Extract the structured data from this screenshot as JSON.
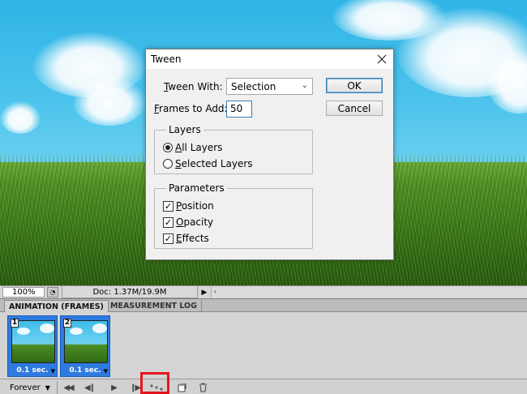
{
  "dialog": {
    "title": "Tween",
    "tween_with": {
      "label_underlined": "T",
      "label_rest": "ween With:",
      "value": "Selection"
    },
    "frames_to_add": {
      "label_pre": "",
      "label_underlined": "F",
      "label_rest": "rames to Add:",
      "value": "50"
    },
    "ok_label": "OK",
    "cancel_label": "Cancel",
    "layers": {
      "title": "Layers",
      "options": [
        {
          "u": "A",
          "rest": "ll Layers",
          "selected": true
        },
        {
          "u": "S",
          "rest": "elected Layers",
          "selected": false
        }
      ]
    },
    "parameters": {
      "title": "Parameters",
      "options": [
        {
          "u": "P",
          "rest": "osition",
          "checked": true
        },
        {
          "u": "O",
          "rest": "pacity",
          "checked": true
        },
        {
          "u": "E",
          "rest": "ffects",
          "checked": true
        }
      ]
    }
  },
  "status": {
    "zoom": "100%",
    "doc": "Doc: 1.37M/19.9M"
  },
  "panel": {
    "tabs": [
      "ANIMATION (FRAMES)",
      "MEASUREMENT LOG"
    ],
    "frames": [
      {
        "number": "1",
        "delay": "0.1 sec."
      },
      {
        "number": "2",
        "delay": "0.1 sec."
      }
    ],
    "loop": "Forever"
  },
  "colors": {
    "highlight": "#e8141e",
    "frame_selected": "#2f7ae0",
    "focus": "#3c7fb1"
  }
}
